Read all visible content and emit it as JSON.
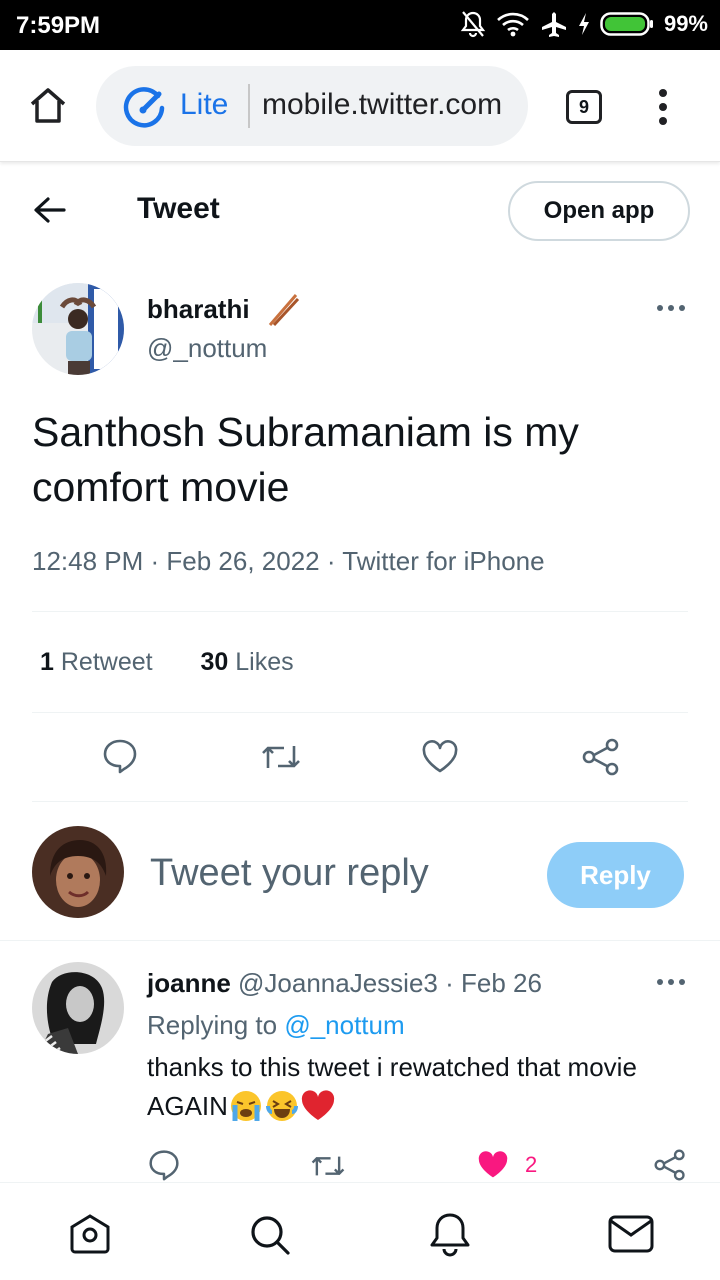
{
  "status_bar": {
    "time": "7:59PM",
    "battery": "99%"
  },
  "browser": {
    "mode_label": "Lite",
    "url": "mobile.twitter.com",
    "tab_count": "9"
  },
  "header": {
    "title": "Tweet",
    "open_app_label": "Open app"
  },
  "tweet": {
    "author_name": "bharathi",
    "author_handle": "@_nottum",
    "text": "Santhosh Subramaniam is my comfort movie",
    "time": "12:48 PM",
    "date": "Feb 26, 2022",
    "source": "Twitter for iPhone",
    "retweets_count": "1",
    "retweets_label": "Retweet",
    "likes_count": "30",
    "likes_label": "Likes"
  },
  "compose": {
    "placeholder": "Tweet your reply",
    "reply_button": "Reply"
  },
  "replies": [
    {
      "author_name": "joanne",
      "author_handle": "@JoannaJessie3",
      "date": "Feb 26",
      "replying_to_label": "Replying to",
      "replying_to_handle": "@_nottum",
      "text_line1": "thanks to this tweet i rewatched that movie",
      "text_line2": "AGAIN",
      "like_count": "2"
    }
  ],
  "colors": {
    "accent": "#1d9bf0",
    "like": "#f91880",
    "reply_button_disabled": "#8ecdf8",
    "muted": "#536471"
  },
  "icons": {
    "bottom_nav": [
      "home-icon",
      "search-icon",
      "notifications-icon",
      "messages-icon"
    ],
    "tweet_actions": [
      "reply-icon",
      "retweet-icon",
      "like-icon",
      "share-icon"
    ]
  }
}
